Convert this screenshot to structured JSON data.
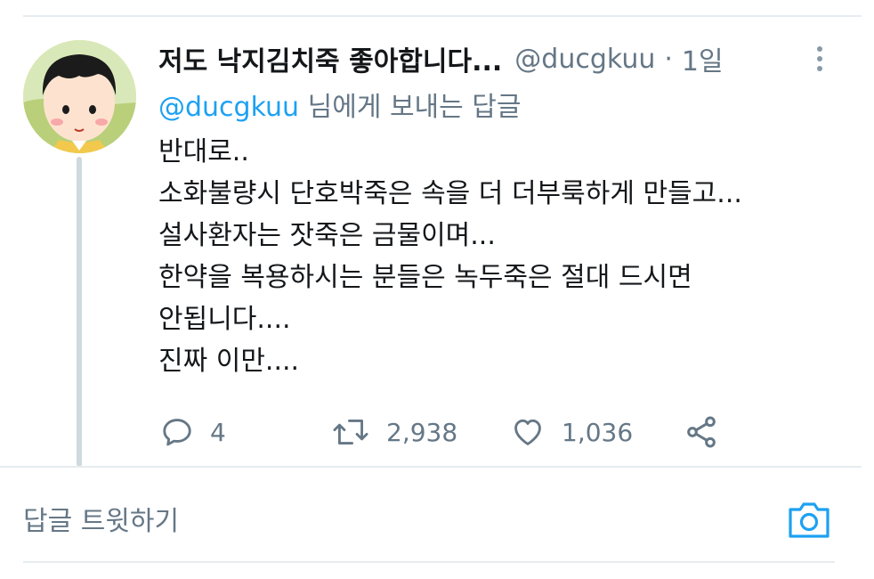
{
  "tweet": {
    "display_name": "저도 낙지김치죽 좋아합니다...",
    "handle": "@ducgkuu",
    "separator": "·",
    "time": "1일",
    "reply_to_mention": "@ducgkuu",
    "reply_to_suffix": " 님에게 보내는 답글",
    "body_lines": [
      "반대로..",
      "소화불량시 단호박죽은 속을 더 더부룩하게 만들고...",
      "설사환자는 잣죽은 금물이며...",
      "한약을 복용하시는 분들은 녹두죽은 절대 드시면",
      "안됩니다....",
      "진짜 이만...."
    ]
  },
  "actions": {
    "reply": {
      "icon": "reply-icon",
      "count": "4"
    },
    "retweet": {
      "icon": "retweet-icon",
      "count": "2,938"
    },
    "like": {
      "icon": "heart-icon",
      "count": "1,036"
    },
    "share": {
      "icon": "share-icon"
    }
  },
  "compose": {
    "placeholder": "답글 트윗하기",
    "camera_icon": "camera-icon"
  },
  "colors": {
    "accent": "#1da1f2",
    "muted": "#657786",
    "text": "#14171a",
    "divider": "#e6ecf0"
  }
}
